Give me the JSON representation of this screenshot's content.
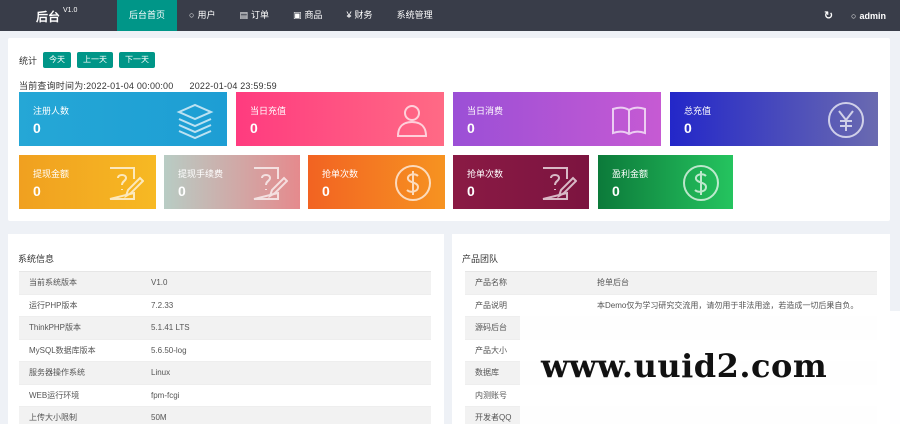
{
  "brand": {
    "name": "后台",
    "version": "V1.0"
  },
  "nav": [
    {
      "label": "后台首页",
      "icon": ""
    },
    {
      "label": "用户",
      "icon": "user-icon"
    },
    {
      "label": "订单",
      "icon": "document-icon"
    },
    {
      "label": "商品",
      "icon": "cart-icon"
    },
    {
      "label": "财务",
      "icon": "yen-icon"
    },
    {
      "label": "系统管理",
      "icon": ""
    }
  ],
  "topright": {
    "user": "admin"
  },
  "stats": {
    "label": "统计",
    "buttons": [
      "今天",
      "上一天",
      "下一天"
    ],
    "query_time": "当前查询时间为:2022-01-04 00:00:00",
    "query_time_end": "2022-01-04 23:59:59"
  },
  "tiles": [
    {
      "label": "注册人数",
      "value": "0",
      "icon": "stack-icon",
      "colors": [
        "#25a7d6",
        "#1d9ed4"
      ]
    },
    {
      "label": "当日充值",
      "value": "0",
      "icon": "users-icon",
      "colors": [
        "#ff3b7f",
        "#ff6a85"
      ]
    },
    {
      "label": "当日消费",
      "value": "0",
      "icon": "book-icon",
      "colors": [
        "#9b4fd6",
        "#c65ad3"
      ]
    },
    {
      "label": "总充值",
      "value": "0",
      "icon": "yen-circle-icon",
      "colors": [
        "#2327c9",
        "#6a6ab0"
      ]
    },
    {
      "label": "提现金额",
      "value": "0",
      "icon": "edit-doc-icon",
      "colors": [
        "#f0a020",
        "#f7b923"
      ]
    },
    {
      "label": "提现手续费",
      "value": "0",
      "icon": "edit-doc-icon",
      "colors": [
        "#b8ccc4",
        "#e58a8d"
      ]
    },
    {
      "label": "抢单次数",
      "value": "0",
      "icon": "dollar-icon",
      "colors": [
        "#f26322",
        "#f69321"
      ]
    },
    {
      "label": "抢单次数",
      "value": "0",
      "icon": "edit-doc-icon",
      "colors": [
        "#8a1a44",
        "#7c1440"
      ]
    },
    {
      "label": "盈利金额",
      "value": "0",
      "icon": "dollar-icon",
      "colors": [
        "#0c7a3a",
        "#25c45f"
      ]
    }
  ],
  "system": {
    "title": "系统信息",
    "rows": [
      {
        "k": "当前系统版本",
        "v": "V1.0"
      },
      {
        "k": "运行PHP版本",
        "v": "7.2.33"
      },
      {
        "k": "ThinkPHP版本",
        "v": "5.1.41 LTS"
      },
      {
        "k": "MySQL数据库版本",
        "v": "5.6.50-log"
      },
      {
        "k": "服务器操作系统",
        "v": "Linux"
      },
      {
        "k": "WEB运行环境",
        "v": "fpm-fcgi"
      },
      {
        "k": "上传大小限制",
        "v": "50M"
      }
    ]
  },
  "product": {
    "title": "产品团队",
    "rows": [
      {
        "k": "产品名称",
        "v": "抢单后台"
      },
      {
        "k": "产品说明",
        "v": "本Demo仅为学习研究交流用，请勿用于非法用途，若造成一切后果自负。"
      },
      {
        "k": "源码后台",
        "v": ""
      },
      {
        "k": "产品大小",
        "v": ""
      },
      {
        "k": "数据库",
        "v": ""
      },
      {
        "k": "内测账号",
        "v": ""
      },
      {
        "k": "开发者QQ",
        "v": ""
      }
    ]
  },
  "watermark": "www.uuid2.com"
}
